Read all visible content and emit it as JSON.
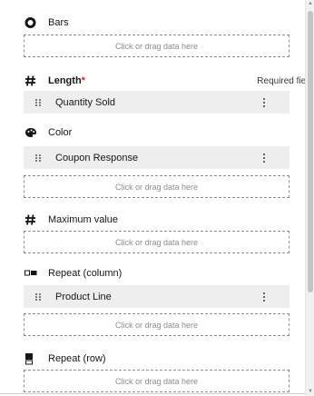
{
  "drop_hint": "Click or drag data here",
  "sections": {
    "bars": {
      "label": "Bars",
      "icon": "circle-ring-icon"
    },
    "length": {
      "label": "Length",
      "required_marker": "*",
      "required_note": "Required field",
      "icon": "hash-icon",
      "chip": "Quantity Sold"
    },
    "color": {
      "label": "Color",
      "icon": "palette-icon",
      "chip": "Coupon Response"
    },
    "maximum": {
      "label": "Maximum value",
      "icon": "hash-icon"
    },
    "repeat_column": {
      "label": "Repeat (column)",
      "icon": "columns-icon",
      "chip": "Product Line"
    },
    "repeat_row": {
      "label": "Repeat (row)",
      "icon": "rows-icon"
    }
  },
  "colors": {
    "required": "#da1e28",
    "chip_bg": "#eeeeee",
    "dash": "#8d8d8d"
  }
}
